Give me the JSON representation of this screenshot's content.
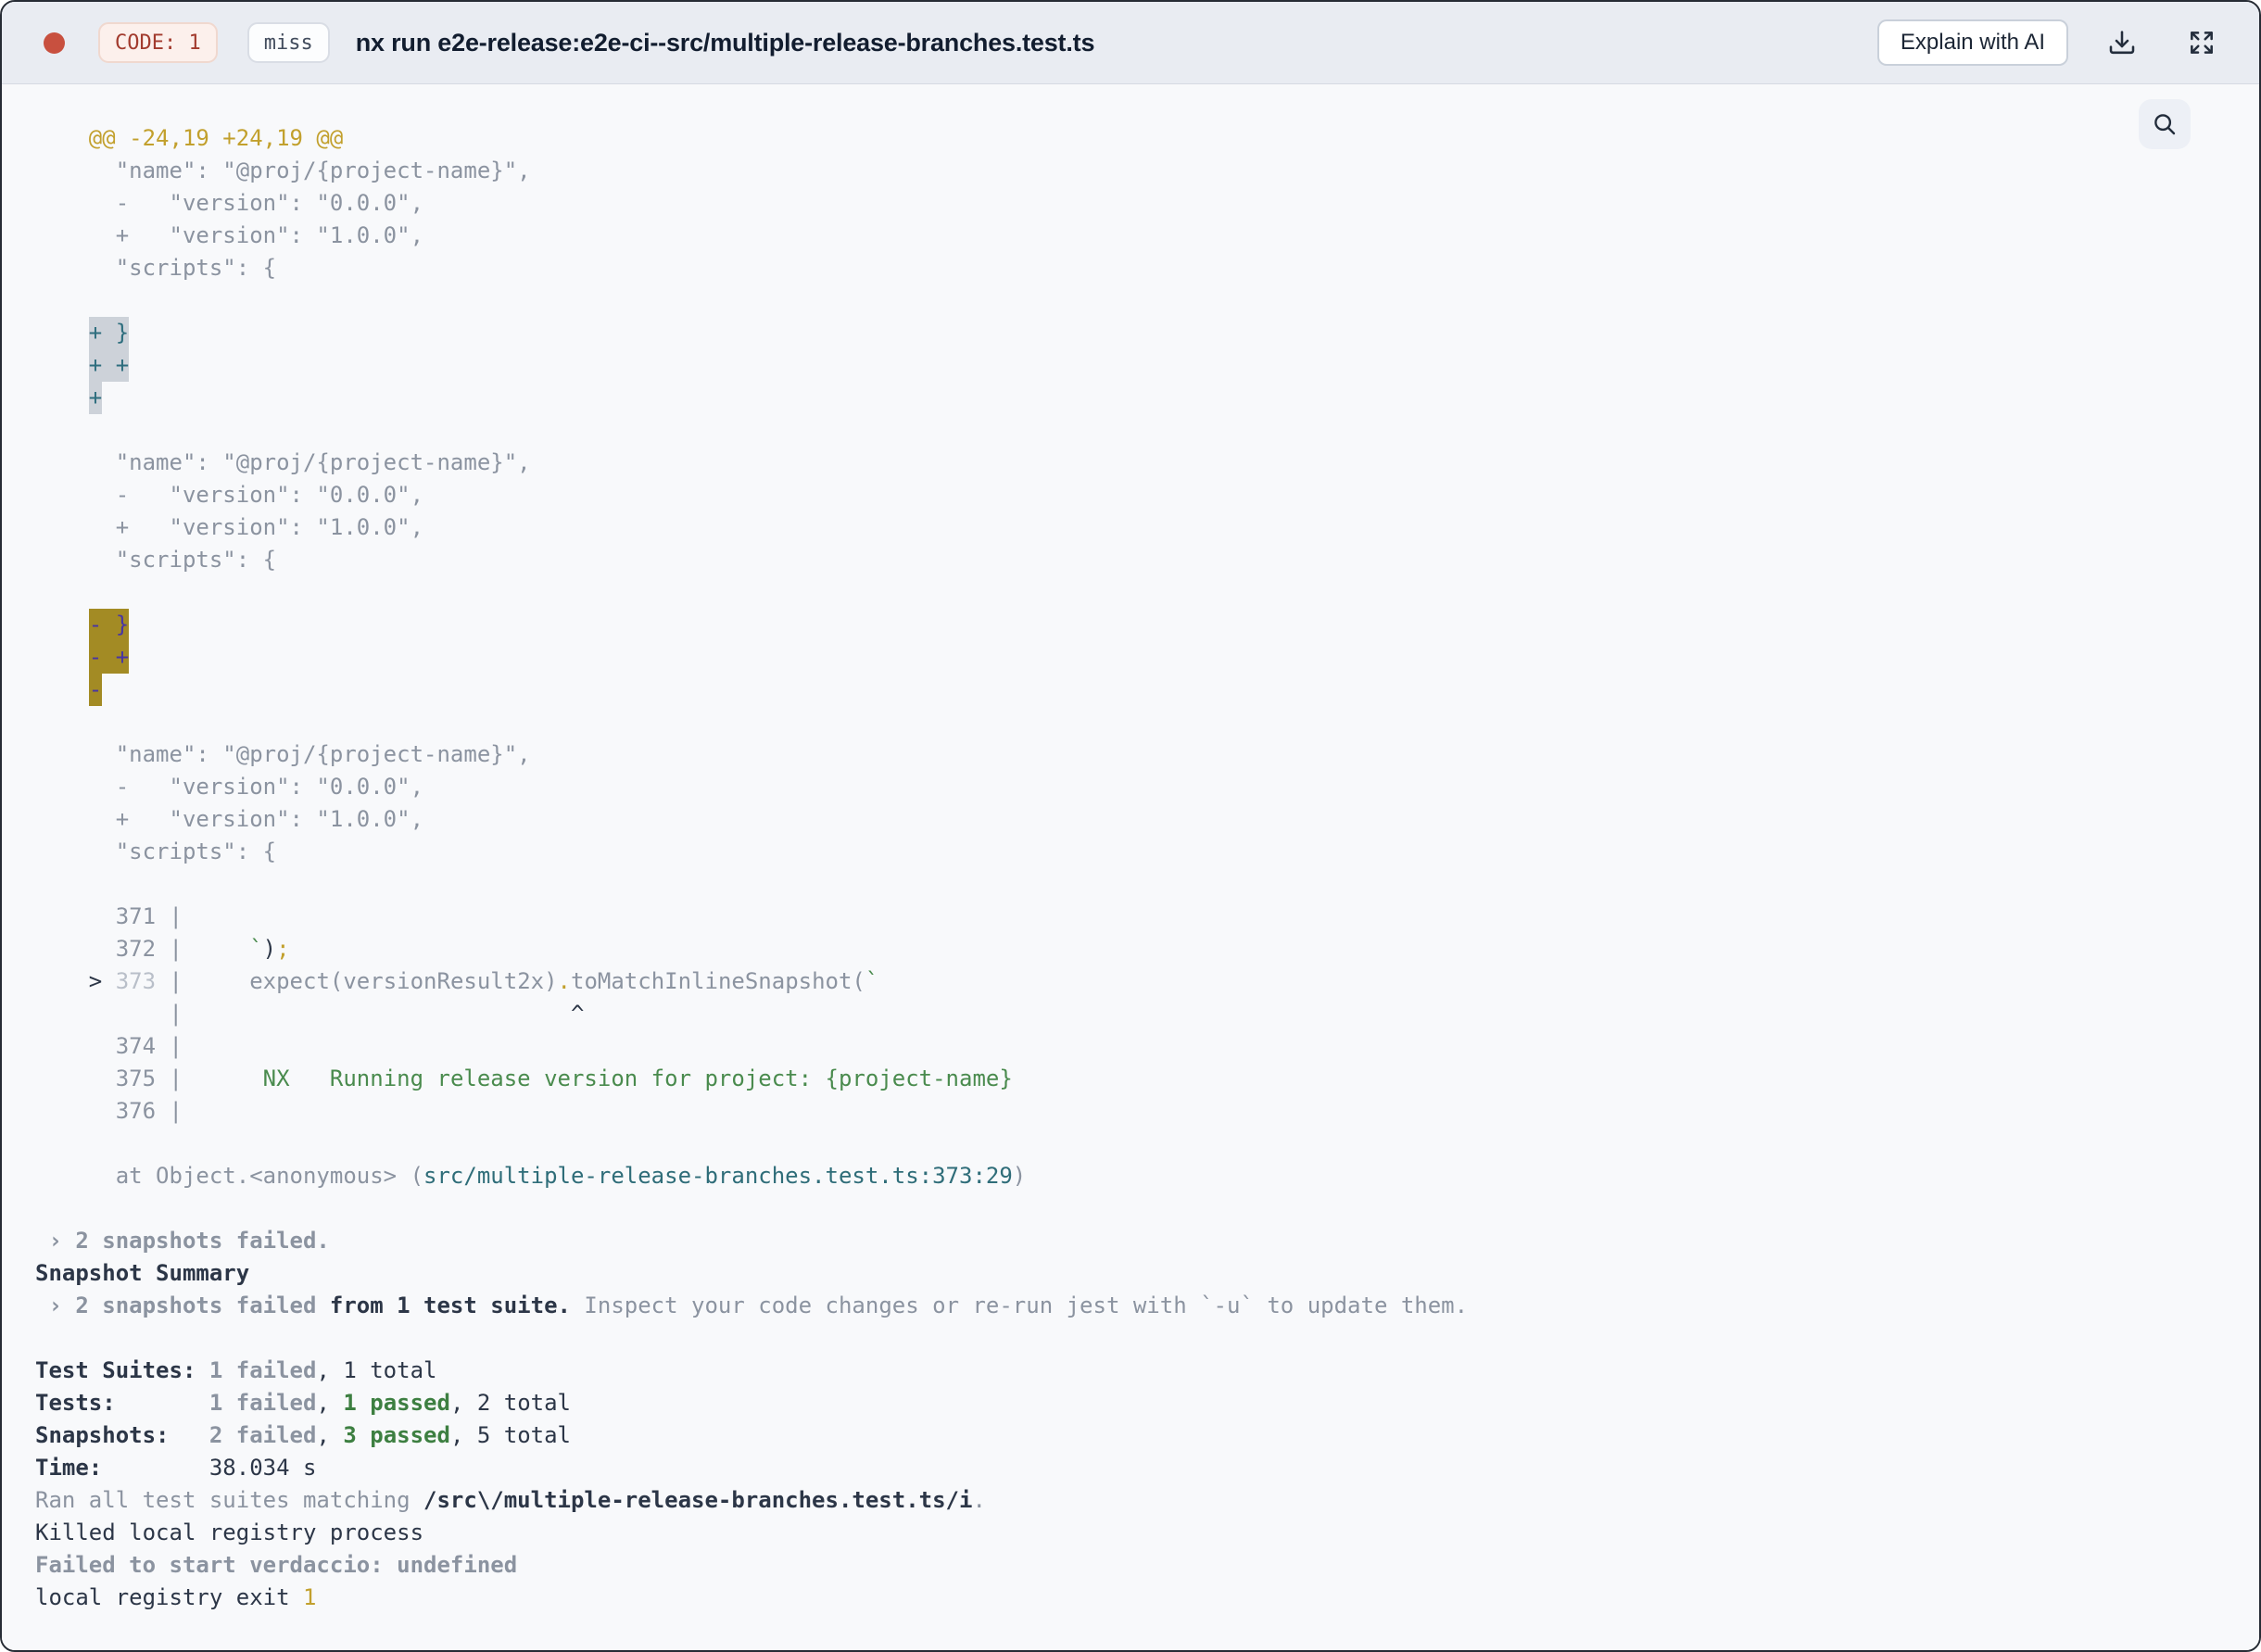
{
  "header": {
    "exit_code_badge": "CODE: 1",
    "cache_status_badge": "miss",
    "title": "nx run e2e-release:e2e-ci--src/multiple-release-branches.test.ts",
    "explain_button_label": "Explain with AI"
  },
  "icons": [
    "status-dot-icon",
    "download-icon",
    "fullscreen-icon",
    "search-icon"
  ],
  "colors": {
    "status_dot": "#c8503f",
    "badge_red_text": "#a23b2e",
    "badge_red_bg": "#fcf0ec",
    "header_bg": "#e9ecf2",
    "terminal_bg": "#f8f9fb",
    "text_dim": "#8b93a0",
    "text_dark": "#2c3647",
    "gold": "#c2a02d",
    "green": "#4a8b4e",
    "teal_path": "#2f6d79",
    "highlight_gray_bg": "#cdd2d9",
    "highlight_gray_text": "#2e6e7e",
    "highlight_gold_bg": "#a38b24",
    "highlight_gold_text": "#4936a3"
  },
  "terminal": {
    "lines": [
      [
        [
          "g",
          "    @@ -24,19 +24,19 @@"
        ]
      ],
      [
        [
          "d",
          "      \"name\": \"@proj/{project-name}\","
        ]
      ],
      [
        [
          "d",
          "      -   \"version\": \"0.0.0\","
        ]
      ],
      [
        [
          "d",
          "      +   \"version\": \"1.0.0\","
        ]
      ],
      [
        [
          "d",
          "      \"scripts\": {"
        ]
      ],
      [],
      [
        [
          "d",
          "    "
        ],
        [
          "hg",
          "+ }"
        ]
      ],
      [
        [
          "d",
          "    "
        ],
        [
          "hg",
          "+ +"
        ]
      ],
      [
        [
          "d",
          "    "
        ],
        [
          "hg",
          "+"
        ]
      ],
      [],
      [
        [
          "d",
          "      \"name\": \"@proj/{project-name}\","
        ]
      ],
      [
        [
          "d",
          "      -   \"version\": \"0.0.0\","
        ]
      ],
      [
        [
          "d",
          "      +   \"version\": \"1.0.0\","
        ]
      ],
      [
        [
          "d",
          "      \"scripts\": {"
        ]
      ],
      [],
      [
        [
          "d",
          "    "
        ],
        [
          "hy",
          "- }"
        ]
      ],
      [
        [
          "d",
          "    "
        ],
        [
          "hy",
          "- +"
        ]
      ],
      [
        [
          "d",
          "    "
        ],
        [
          "hy",
          "-"
        ]
      ],
      [],
      [
        [
          "d",
          "      \"name\": \"@proj/{project-name}\","
        ]
      ],
      [
        [
          "d",
          "      -   \"version\": \"0.0.0\","
        ]
      ],
      [
        [
          "d",
          "      +   \"version\": \"1.0.0\","
        ]
      ],
      [
        [
          "d",
          "      \"scripts\": {"
        ]
      ],
      [],
      [
        [
          "d",
          "      371 |"
        ]
      ],
      [
        [
          "d",
          "      372 |     "
        ],
        [
          "gr",
          "`"
        ],
        [
          "k",
          ")"
        ],
        [
          "g",
          ";"
        ]
      ],
      [
        [
          "d",
          "    "
        ],
        [
          "k",
          ">"
        ],
        [
          "d",
          " "
        ],
        [
          "f",
          "373"
        ],
        [
          "d",
          " |     expect(versionResult2x)"
        ],
        [
          "g",
          "."
        ],
        [
          "d",
          "toMatchInlineSnapshot("
        ],
        [
          "gr",
          "`"
        ]
      ],
      [
        [
          "d",
          "          |                             "
        ],
        [
          "k",
          "^"
        ]
      ],
      [
        [
          "d",
          "      374 |"
        ]
      ],
      [
        [
          "d",
          "      375 |"
        ],
        [
          "gr",
          "      NX   Running release version for project: {project-name}"
        ]
      ],
      [
        [
          "d",
          "      376 |"
        ]
      ],
      [],
      [
        [
          "d",
          "      at Object.<anonymous> ("
        ],
        [
          "t",
          "src/multiple-release-branches.test.ts:373:29"
        ],
        [
          "d",
          ")"
        ]
      ],
      [],
      [
        [
          "bd",
          " › 2 snapshots failed."
        ]
      ],
      [
        [
          "bk",
          "Snapshot Summary"
        ]
      ],
      [
        [
          "bd",
          " › 2 snapshots failed"
        ],
        [
          "bk",
          " from 1 test suite."
        ],
        [
          "d",
          " Inspect your code changes or re-run jest with `-u` to update them."
        ]
      ],
      [],
      [
        [
          "bk",
          "Test Suites: "
        ],
        [
          "bd",
          "1 failed"
        ],
        [
          "k",
          ", 1 total"
        ]
      ],
      [
        [
          "bk",
          "Tests:"
        ],
        [
          "k",
          "       "
        ],
        [
          "bd",
          "1 failed"
        ],
        [
          "k",
          ", "
        ],
        [
          "bgr",
          "1 passed"
        ],
        [
          "k",
          ", 2 total"
        ]
      ],
      [
        [
          "bk",
          "Snapshots:"
        ],
        [
          "k",
          "   "
        ],
        [
          "bd",
          "2 failed"
        ],
        [
          "k",
          ", "
        ],
        [
          "bgr",
          "3 passed"
        ],
        [
          "k",
          ", 5 total"
        ]
      ],
      [
        [
          "bk",
          "Time:"
        ],
        [
          "k",
          "        38.034 s"
        ]
      ],
      [
        [
          "d",
          "Ran all test suites matching "
        ],
        [
          "bk",
          "/src\\/multiple-release-branches.test.ts/i"
        ],
        [
          "d",
          "."
        ]
      ],
      [
        [
          "k",
          "Killed local registry process"
        ]
      ],
      [
        [
          "bd",
          "Failed to start verdaccio: undefined"
        ]
      ],
      [
        [
          "k",
          "local registry exit "
        ],
        [
          "g",
          "1"
        ]
      ]
    ]
  }
}
